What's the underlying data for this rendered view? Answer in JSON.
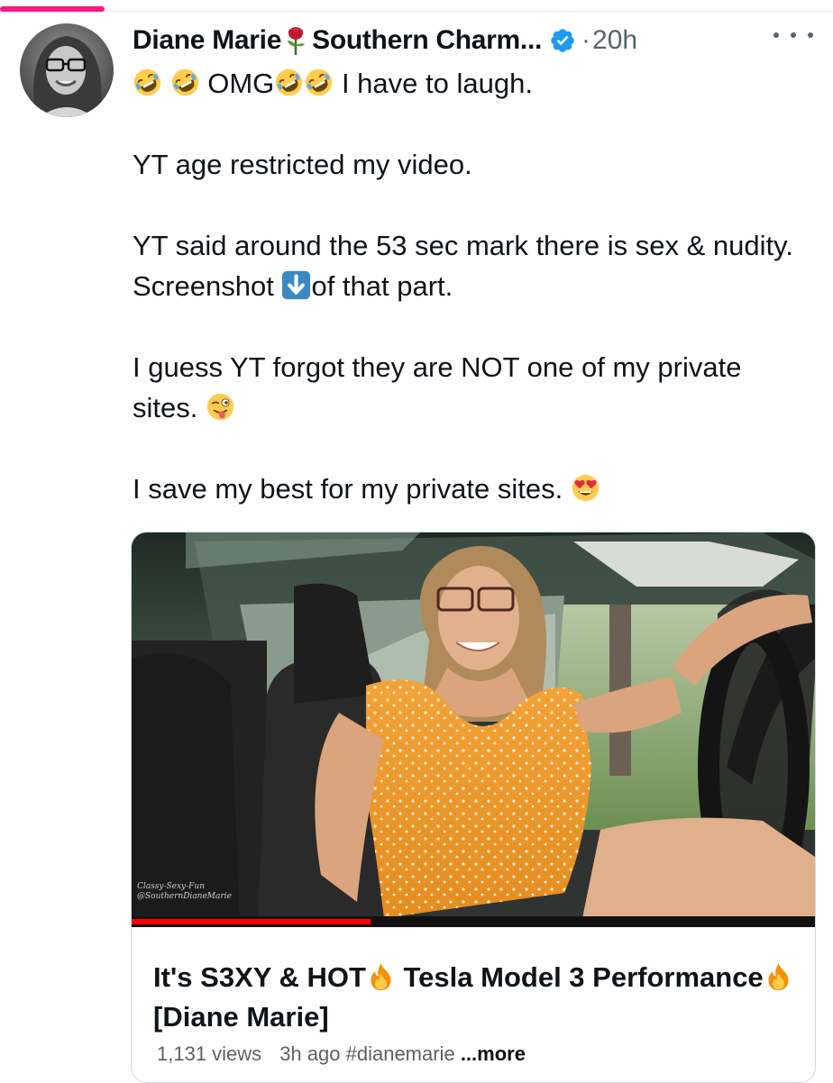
{
  "post": {
    "author_name": "Diane Marie",
    "author_suffix": "Southern Charm...",
    "separator": "·",
    "time": "20h"
  },
  "tweet": {
    "line1_omg": "OMG",
    "line1_end": "I have to laugh.",
    "p2": "YT age restricted my video.",
    "p3_a": "YT said around the 53 sec mark there is sex & nudity. Screenshot",
    "p3_b": "of that part.",
    "p4": "I guess YT forgot they are NOT one of my private sites.",
    "p5": "I save my best for my private sites."
  },
  "video": {
    "watermark_line1": "Classy-Sexy-Fun",
    "watermark_line2": "@SouthernDianeMarie",
    "title_a": "It's S3XY & HOT",
    "title_b": "Tesla Model 3 Performance",
    "title_c": "[Diane Marie]",
    "views": "1,131 views",
    "age": "3h ago",
    "hashtag": "#dianemarie",
    "more": "...more",
    "progress_fraction": 0.35
  },
  "icons": {
    "rose": "rose-icon",
    "verified": "verified-badge-icon",
    "rofl": "rolling-laughing-emoji",
    "down_arrow": "down-arrow-emoji",
    "winking_tongue": "winking-tongue-emoji",
    "heart_eyes": "heart-eyes-emoji",
    "fire": "fire-emoji",
    "more": "more-options-icon"
  },
  "colors": {
    "accent_pink": "#f91880",
    "verified_blue": "#1d9bf0",
    "progress_red": "#ff0000",
    "secondary_text": "#536471"
  }
}
